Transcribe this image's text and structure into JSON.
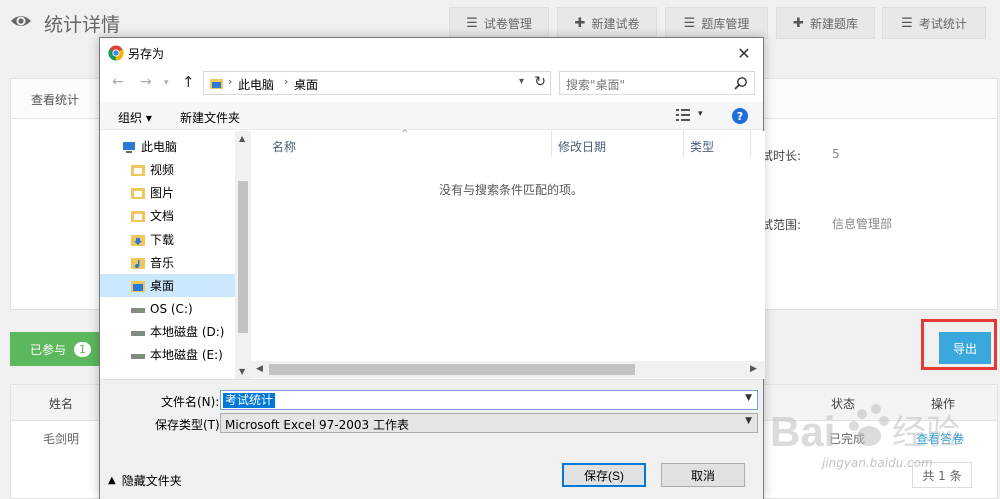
{
  "page": {
    "title": "统计详情",
    "top_buttons": [
      {
        "icon": "list-icon",
        "glyph": "☰",
        "label": "试卷管理"
      },
      {
        "icon": "plus-icon",
        "glyph": "✚",
        "label": "新建试卷"
      },
      {
        "icon": "list-icon",
        "glyph": "☰",
        "label": "题库管理"
      },
      {
        "icon": "plus-icon",
        "glyph": "✚",
        "label": "新建题库"
      },
      {
        "icon": "list-icon",
        "glyph": "☰",
        "label": "考试统计"
      }
    ],
    "panel_heading": "查看统计",
    "duration_label": "试时长:",
    "duration_value": "5",
    "scope_label": "试范围:",
    "scope_value": "信息管理部",
    "joined_tab": {
      "label": "已参与",
      "count": "1"
    },
    "export_label": "导出",
    "table": {
      "headers": {
        "name": "姓名",
        "status": "状态",
        "action": "操作"
      },
      "row": {
        "name": "毛剑明",
        "status": "已完成",
        "action": "查看答卷"
      }
    },
    "pagination": "共 1 条",
    "watermark": {
      "logo": "Baidu经验",
      "url": "jingyan.baidu.com"
    }
  },
  "dialog": {
    "title": "另存为",
    "close_glyph": "✕",
    "breadcrumb": [
      "此电脑",
      "桌面"
    ],
    "search_placeholder": "搜索\"桌面\"",
    "toolbar": {
      "organize": "组织 ▾",
      "new_folder": "新建文件夹",
      "help": "?"
    },
    "nav_items": [
      {
        "label": "此电脑",
        "icon": "computer-icon",
        "selected": false,
        "indent": 1
      },
      {
        "label": "视频",
        "icon": "video-folder-icon",
        "selected": false,
        "indent": 2
      },
      {
        "label": "图片",
        "icon": "pictures-folder-icon",
        "selected": false,
        "indent": 2
      },
      {
        "label": "文档",
        "icon": "documents-folder-icon",
        "selected": false,
        "indent": 2
      },
      {
        "label": "下载",
        "icon": "downloads-folder-icon",
        "selected": false,
        "indent": 2
      },
      {
        "label": "音乐",
        "icon": "music-folder-icon",
        "selected": false,
        "indent": 2
      },
      {
        "label": "桌面",
        "icon": "desktop-folder-icon",
        "selected": true,
        "indent": 2
      },
      {
        "label": "OS (C:)",
        "icon": "drive-icon",
        "selected": false,
        "indent": 2
      },
      {
        "label": "本地磁盘 (D:)",
        "icon": "drive-icon",
        "selected": false,
        "indent": 2
      },
      {
        "label": "本地磁盘 (E:)",
        "icon": "drive-icon",
        "selected": false,
        "indent": 2
      }
    ],
    "columns": {
      "name": "名称",
      "modified": "修改日期",
      "type": "类型"
    },
    "empty_message": "没有与搜索条件匹配的项。",
    "filename_label": "文件名(N):",
    "filename_value": "考试统计",
    "filetype_label": "保存类型(T):",
    "filetype_value": "Microsoft Excel 97-2003 工作表",
    "hide_folders": "隐藏文件夹",
    "save_button": "保存(S)",
    "cancel_button": "取消"
  },
  "colors": {
    "accent_green": "#5cb85c",
    "export_blue": "#3aa8dc",
    "highlight_red": "#e53935",
    "selection_blue": "#0078d7"
  }
}
